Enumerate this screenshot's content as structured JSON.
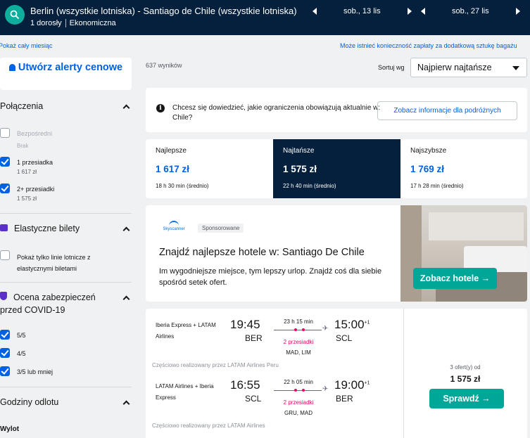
{
  "header": {
    "route": "Berlin (wszystkie lotniska) - Santiago de Chile (wszystkie lotniska)",
    "passengers": "1 dorosły",
    "cabin": "Ekonomiczna",
    "date_out": "sob., 13 lis",
    "date_back": "sob., 27 lis"
  },
  "links": {
    "month": "Pokaż cały miesiąc",
    "baggage": "Może istnieć konieczność zapłaty za dodatkową sztukę bagażu"
  },
  "sidebar": {
    "alert_button": "Utwórz alerty cenowe",
    "connections_title": "Połączenia",
    "direct": {
      "label": "Bezpośredni",
      "sub": "Brak"
    },
    "one_stop": {
      "label": "1 przesiadka",
      "sub": "1 617 zł"
    },
    "two_stop": {
      "label": "2+ przesiadki",
      "sub": "1 575 zł"
    },
    "flexible_title": "Elastyczne bilety",
    "flexible_option": "Pokaż tylko linie lotnicze z elastycznymi biletami",
    "covid_title": "Ocena zabezpieczeń przed COVID-19",
    "covid_options": [
      "5/5",
      "4/5",
      "3/5 lub mniej"
    ],
    "departure_title": "Godziny odlotu",
    "outbound_label": "Wylot"
  },
  "results": {
    "count": "637 wyników",
    "sort_label": "Sortuj wg",
    "sort_value": "Najpierw najtańsze"
  },
  "info": {
    "text": "Chcesz się dowiedzieć, jakie ograniczenia obowiązują aktualnie w: Chile?",
    "button": "Zobacz informacje dla podróżnych"
  },
  "tabs": [
    {
      "title": "Najlepsze",
      "price": "1 617 zł",
      "time": "18 h 30 min (średnio)"
    },
    {
      "title": "Najtańsze",
      "price": "1 575 zł",
      "time": "22 h 40 min (średnio)"
    },
    {
      "title": "Najszybsze",
      "price": "1 769 zł",
      "time": "17 h 28 min (średnio)"
    }
  ],
  "ad": {
    "logo": "Skyscanner",
    "badge": "Sponsorowane",
    "title": "Znajdź najlepsze hotele w: Santiago De Chile",
    "desc": "Im wygodniejsze miejsce, tym lepszy urlop. Znajdź coś dla siebie spośród setek ofert.",
    "button": "Zobacz hotele →"
  },
  "flight": {
    "legs": [
      {
        "airline": "Iberia Express + LATAM Airlines",
        "dep_time": "19:45",
        "dep_code": "BER",
        "arr_time": "15:00",
        "arr_plus": "+1",
        "arr_code": "SCL",
        "duration": "23 h 15 min",
        "stops": "2 przesiadki",
        "via": "MAD, LIM",
        "operated": "Częściowo realizowany przez LATAM Airlines Peru"
      },
      {
        "airline": "LATAM Airlines + Iberia Express",
        "dep_time": "16:55",
        "dep_code": "SCL",
        "arr_time": "19:00",
        "arr_plus": "+1",
        "arr_code": "BER",
        "duration": "22 h 05 min",
        "stops": "2 przesiadki",
        "via": "GRU, MAD",
        "operated": "Częściowo realizowany przez LATAM Airlines"
      }
    ],
    "offers": "3 ofert(y) od",
    "price": "1 575 zł",
    "button": "Sprawdź →"
  },
  "colors": {
    "navy": "#05203c",
    "accent": "#0062e3",
    "green": "#00a698",
    "stops": "#e70866"
  }
}
